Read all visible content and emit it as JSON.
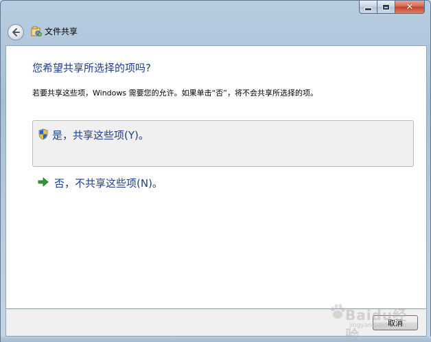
{
  "window": {
    "title": "文件共享",
    "caption_min_icon": "minimize-icon",
    "caption_max_icon": "maximize-icon",
    "caption_close_icon": "close-icon"
  },
  "back_button": {
    "icon": "back-arrow-icon"
  },
  "main": {
    "instruction": "您希望共享所选择的项吗?",
    "description": "若要共享这些项，Windows 需要您的允许。如果单击“否”，将不会共享所选择的项。",
    "options": [
      {
        "label": "是，共享这些项(Y)。",
        "icon": "uac-shield-icon"
      },
      {
        "label": "否，不共享这些项(N)。",
        "icon": "green-arrow-icon"
      }
    ]
  },
  "footer": {
    "cancel_label": "取消"
  },
  "watermark": {
    "text": "Baidu经验",
    "sub": "jingyan.baidu.com"
  },
  "colors": {
    "instruction_text": "#1e3d8a",
    "option_highlight_bg": "#f0f0f0",
    "close_button": "#c2442b",
    "arrow_green": "#2e9a2e"
  }
}
